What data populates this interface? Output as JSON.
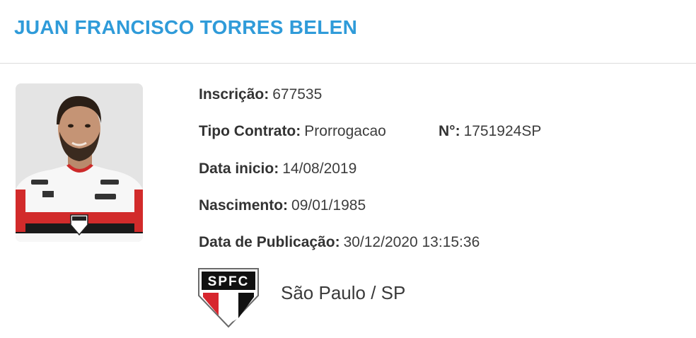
{
  "player": {
    "name": "JUAN FRANCISCO TORRES BELEN"
  },
  "fields": {
    "inscricao": {
      "label": "Inscrição:",
      "value": "677535"
    },
    "tipo_contrato": {
      "label": "Tipo Contrato:",
      "value": "Prorrogacao"
    },
    "numero": {
      "label": "N°:",
      "value": "1751924SP"
    },
    "data_inicio": {
      "label": "Data inicio:",
      "value": "14/08/2019"
    },
    "nascimento": {
      "label": "Nascimento:",
      "value": "09/01/1985"
    },
    "data_publicacao": {
      "label": "Data de Publicação:",
      "value": "30/12/2020 13:15:36"
    }
  },
  "club": {
    "crest_text": "SPFC",
    "crest_icon": "spfc-crest-icon",
    "name": "São Paulo / SP"
  },
  "colors": {
    "title": "#2f9bd9",
    "crest_red": "#d7262e",
    "crest_black": "#111111"
  }
}
